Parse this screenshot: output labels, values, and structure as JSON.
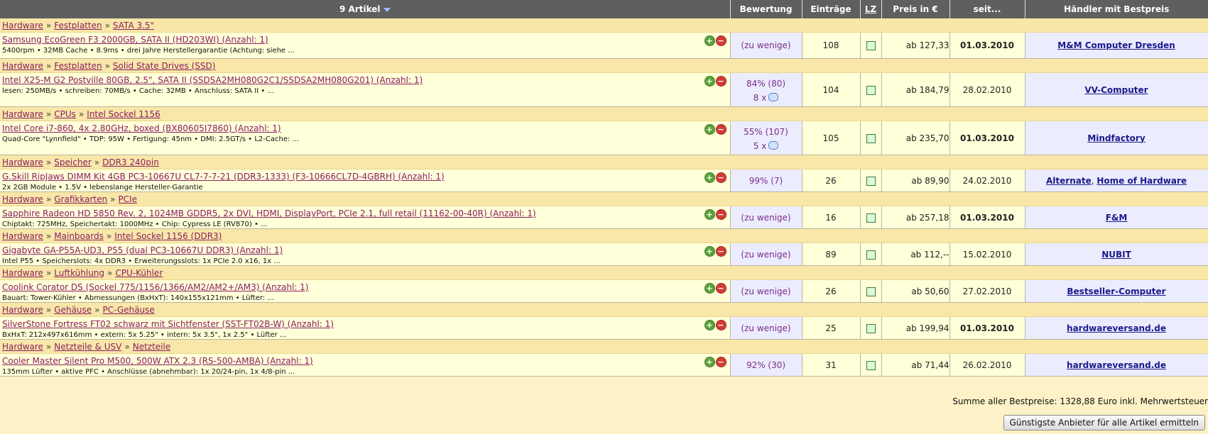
{
  "header": {
    "articles": "9 Artikel",
    "rating": "Bewertung",
    "entries": "Einträge",
    "lz": "LZ",
    "price": "Preis in €",
    "since": "seit...",
    "dealer": "Händler mit Bestpreis"
  },
  "items": [
    {
      "crumbs": [
        "Hardware",
        "Festplatten",
        "SATA 3.5\""
      ],
      "name": "Samsung EcoGreen F3 2000GB, SATA II (HD203WI) (Anzahl: 1)",
      "desc": "5400rpm • 32MB Cache • 8.9ms • drei Jahre Herstellergarantie (Achtung: siehe ...",
      "rating": "(zu wenige)",
      "reviews": "",
      "entries": "108",
      "price": "ab 127,33",
      "since": "01.03.2010",
      "since_bold": true,
      "dealers": [
        "M&M Computer Dresden"
      ]
    },
    {
      "crumbs": [
        "Hardware",
        "Festplatten",
        "Solid State Drives (SSD)"
      ],
      "name": "Intel X25-M G2 Postville 80GB, 2.5\", SATA II (SSDSA2MH080G2C1/SSDSA2MH080G201) (Anzahl: 1)",
      "desc": "lesen: 250MB/s • schreiben: 70MB/s • Cache: 32MB • Anschluss: SATA II • ...",
      "rating": "84% (80)",
      "reviews": "8 x",
      "entries": "104",
      "price": "ab 184,79",
      "since": "28.02.2010",
      "since_bold": false,
      "dealers": [
        "VV-Computer"
      ]
    },
    {
      "crumbs": [
        "Hardware",
        "CPUs",
        "Intel Sockel 1156"
      ],
      "name": "Intel Core i7-860, 4x 2.80GHz, boxed (BX80605I7860) (Anzahl: 1)",
      "desc": "Quad-Core \"Lynnfield\" • TDP: 95W • Fertigung: 45nm • DMI: 2.5GT/s • L2-Cache: ...",
      "rating": "55% (107)",
      "reviews": "5 x",
      "entries": "105",
      "price": "ab 235,70",
      "since": "01.03.2010",
      "since_bold": true,
      "dealers": [
        "Mindfactory"
      ]
    },
    {
      "crumbs": [
        "Hardware",
        "Speicher",
        "DDR3 240pin"
      ],
      "name": "G.Skill RipJaws DIMM Kit 4GB PC3-10667U CL7-7-7-21 (DDR3-1333) (F3-10666CL7D-4GBRH) (Anzahl: 1)",
      "desc": "2x 2GB Module • 1.5V • lebenslange Hersteller-Garantie",
      "rating": "99% (7)",
      "reviews": "",
      "entries": "26",
      "price": "ab 89,90",
      "since": "24.02.2010",
      "since_bold": false,
      "dealers": [
        "Alternate",
        "Home of Hardware"
      ]
    },
    {
      "crumbs": [
        "Hardware",
        "Grafikkarten",
        "PCIe"
      ],
      "name": "Sapphire Radeon HD 5850 Rev. 2, 1024MB GDDR5, 2x DVI, HDMI, DisplayPort, PCIe 2.1, full retail (11162-00-40R) (Anzahl: 1)",
      "desc": "Chiptakt: 725MHz, Speichertakt: 1000MHz • Chip: Cypress LE (RV870) • ...",
      "rating": "(zu wenige)",
      "reviews": "",
      "entries": "16",
      "price": "ab 257,18",
      "since": "01.03.2010",
      "since_bold": true,
      "dealers": [
        "F&M"
      ]
    },
    {
      "crumbs": [
        "Hardware",
        "Mainboards",
        "Intel Sockel 1156 (DDR3)"
      ],
      "name": "Gigabyte GA-P55A-UD3, P55 (dual PC3-10667U DDR3) (Anzahl: 1)",
      "desc": "Intel P55 • Speicherslots: 4x DDR3 • Erweiterungsslots: 1x PCIe 2.0 x16, 1x ...",
      "rating": "(zu wenige)",
      "reviews": "",
      "entries": "89",
      "price": "ab 112,--",
      "since": "15.02.2010",
      "since_bold": false,
      "dealers": [
        "NUBIT"
      ]
    },
    {
      "crumbs": [
        "Hardware",
        "Luftkühlung",
        "CPU-Kühler"
      ],
      "name": "Coolink Corator DS (Sockel 775/1156/1366/AM2/AM2+/AM3) (Anzahl: 1)",
      "desc": "Bauart: Tower-Kühler • Abmessungen (BxHxT): 140x155x121mm • Lüfter: ...",
      "rating": "(zu wenige)",
      "reviews": "",
      "entries": "26",
      "price": "ab 50,60",
      "since": "27.02.2010",
      "since_bold": false,
      "dealers": [
        "Bestseller-Computer"
      ]
    },
    {
      "crumbs": [
        "Hardware",
        "Gehäuse",
        "PC-Gehäuse"
      ],
      "name": "SilverStone Fortress FT02 schwarz mit Sichtfenster (SST-FT02B-W) (Anzahl: 1)",
      "desc": "BxHxT: 212x497x616mm • extern: 5x 5.25\" • intern: 5x 3.5\", 1x 2.5\" • Lüfter ...",
      "rating": "(zu wenige)",
      "reviews": "",
      "entries": "25",
      "price": "ab 199,94",
      "since": "01.03.2010",
      "since_bold": true,
      "dealers": [
        "hardwareversand.de"
      ]
    },
    {
      "crumbs": [
        "Hardware",
        "Netzteile & USV",
        "Netzteile"
      ],
      "name": "Cooler Master Silent Pro M500, 500W ATX 2.3 (RS-500-AMBA) (Anzahl: 1)",
      "desc": "135mm Lüfter • aktive PFC • Anschlüsse (abnehmbar): 1x 20/24-pin, 1x 4/8-pin ...",
      "rating": "92% (30)",
      "reviews": "",
      "entries": "31",
      "price": "ab 71,44",
      "since": "26.02.2010",
      "since_bold": false,
      "dealers": [
        "hardwareversand.de"
      ]
    }
  ],
  "summary": "Summe aller Bestpreise: 1328,88 Euro inkl. Mehrwertsteuer",
  "button": "Günstigste Anbieter für alle Artikel ermitteln",
  "colors": {
    "header_bg": "#5f5f5f",
    "link": "#8a1f64",
    "dealer": "#1a1a8c",
    "category_bg": "#f8e7a8",
    "row_bg": "#ffffd9"
  }
}
